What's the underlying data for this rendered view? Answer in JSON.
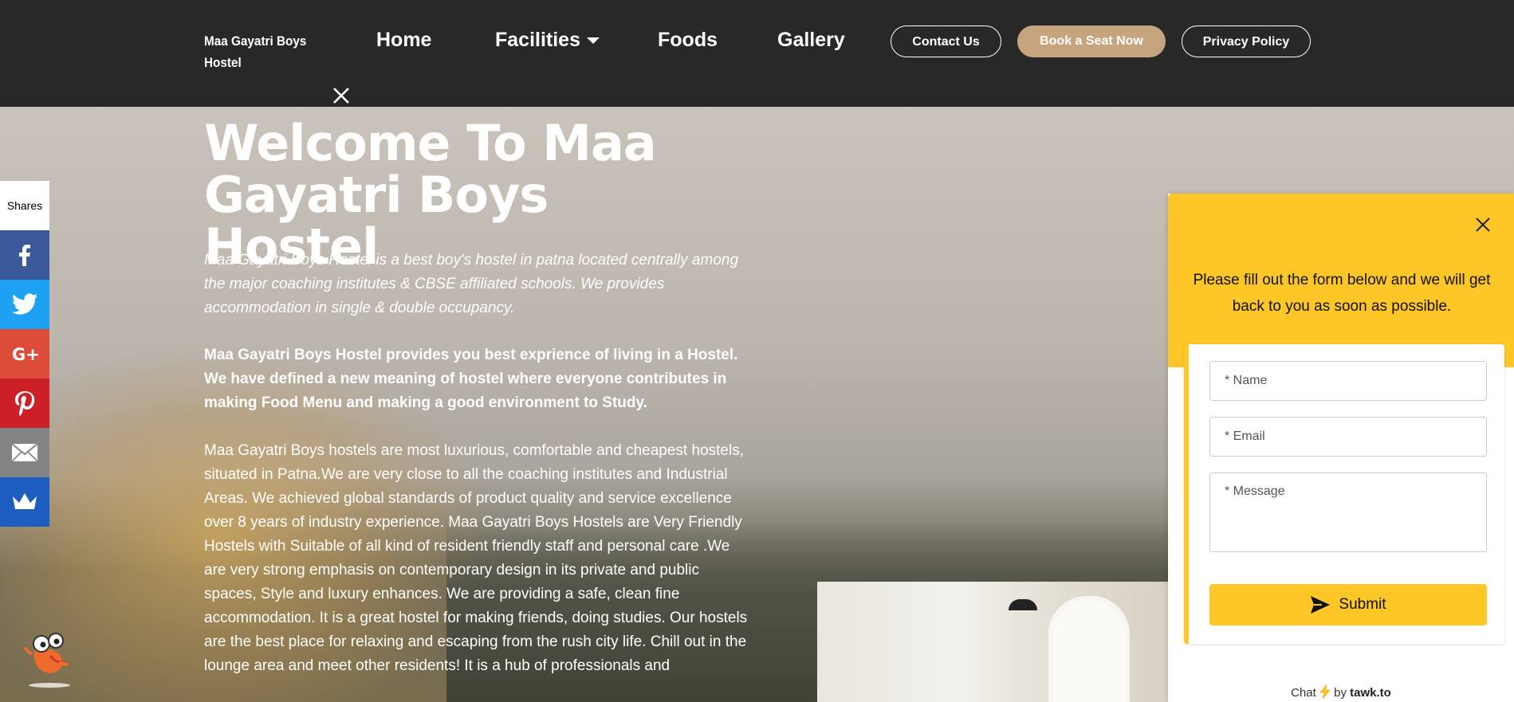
{
  "nav": {
    "brand": "Maa Gayatri Boys Hostel",
    "links": [
      {
        "label": "Home"
      },
      {
        "label": "Facilities"
      },
      {
        "label": "Foods"
      },
      {
        "label": "Gallery"
      }
    ],
    "buttons": {
      "contact": "Contact Us",
      "book": "Book a Seat Now",
      "privacy": "Privacy Policy"
    },
    "icons": {
      "facilities_dropdown": "caret-down-icon",
      "close": "close-icon"
    }
  },
  "hero": {
    "title": "Welcome To Maa Gayatri Boys Hostel",
    "intro": "Maa Gayatri Boys Hostel is a best boy's hostel in patna located centrally among the major coaching institutes & CBSE affiliated schools. We provides accommodation in single & double occupancy.",
    "strong": "Maa Gayatri Boys Hostel provides you best exprience of living in a Hostel. We have defined a new meaning of hostel where everyone contributes in making Food Menu and making a good environment to Study.",
    "body": "Maa Gayatri Boys hostels are most luxurious, comfortable and cheapest hostels, situated in Patna.We are very close to all the coaching institutes and Industrial Areas. We achieved global standards of product quality and service excellence over 8 years of industry experience. Maa Gayatri Boys Hostels are Very Friendly Hostels with Suitable of all kind of resident friendly staff and personal care .We are very strong emphasis on contemporary design in its private and public spaces, Style and luxury enhances. We are providing a safe, clean fine accommodation. It is a great hostel for making friends, doing studies. Our hostels are the best place for relaxing and escaping from the rush city life. Chill out in the lounge area and meet other residents! It is a hub of professionals and"
  },
  "share": {
    "label": "Shares",
    "buttons": [
      {
        "name": "facebook",
        "icon": "facebook-icon",
        "color": "#3b5998"
      },
      {
        "name": "twitter",
        "icon": "twitter-icon",
        "color": "#1da1f2"
      },
      {
        "name": "google-plus",
        "icon": "google-plus-icon",
        "color": "#dd4b39"
      },
      {
        "name": "pinterest",
        "icon": "pinterest-icon",
        "color": "#cb2027"
      },
      {
        "name": "email",
        "icon": "email-icon",
        "color": "#848484"
      },
      {
        "name": "sumome",
        "icon": "crown-icon",
        "color": "#1e5dc0"
      }
    ]
  },
  "chat": {
    "message": "Please fill out the form below and we will get back to you as soon as possible.",
    "fields": {
      "name_placeholder": "* Name",
      "email_placeholder": "* Email",
      "message_placeholder": "* Message"
    },
    "submit_label": "Submit",
    "footer_prefix": "Chat",
    "footer_by": "by",
    "footer_brand": "tawk.to",
    "accent_color": "#ffc627"
  },
  "colors": {
    "nav_bg": "#282828",
    "book_button": "#c5a47e"
  }
}
